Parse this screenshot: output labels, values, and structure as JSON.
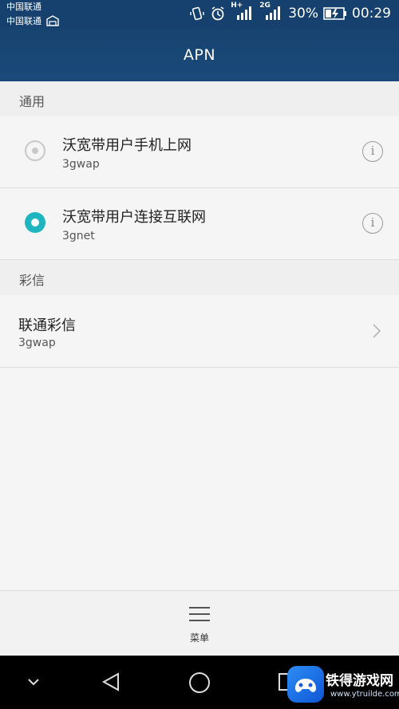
{
  "status_bar": {
    "carrier1": "中国联通",
    "carrier2": "中国联通",
    "network1": "H+",
    "network2": "2G",
    "battery": "30%",
    "time": "00:29"
  },
  "app_bar": {
    "title": "APN"
  },
  "sections": [
    {
      "header": "通用",
      "items": [
        {
          "title": "沃宽带用户手机上网",
          "subtitle": "3gwap",
          "selected": false
        },
        {
          "title": "沃宽带用户连接互联网",
          "subtitle": "3gnet",
          "selected": true
        }
      ]
    },
    {
      "header": "彩信",
      "items": [
        {
          "title": "联通彩信",
          "subtitle": "3gwap"
        }
      ]
    }
  ],
  "bottom_menu": {
    "label": "菜单"
  },
  "watermark": {
    "text": "铁得游戏网",
    "url": "www.ytruilde.com"
  },
  "colors": {
    "appbar": "#17436f",
    "accent": "#1fb5c0"
  }
}
